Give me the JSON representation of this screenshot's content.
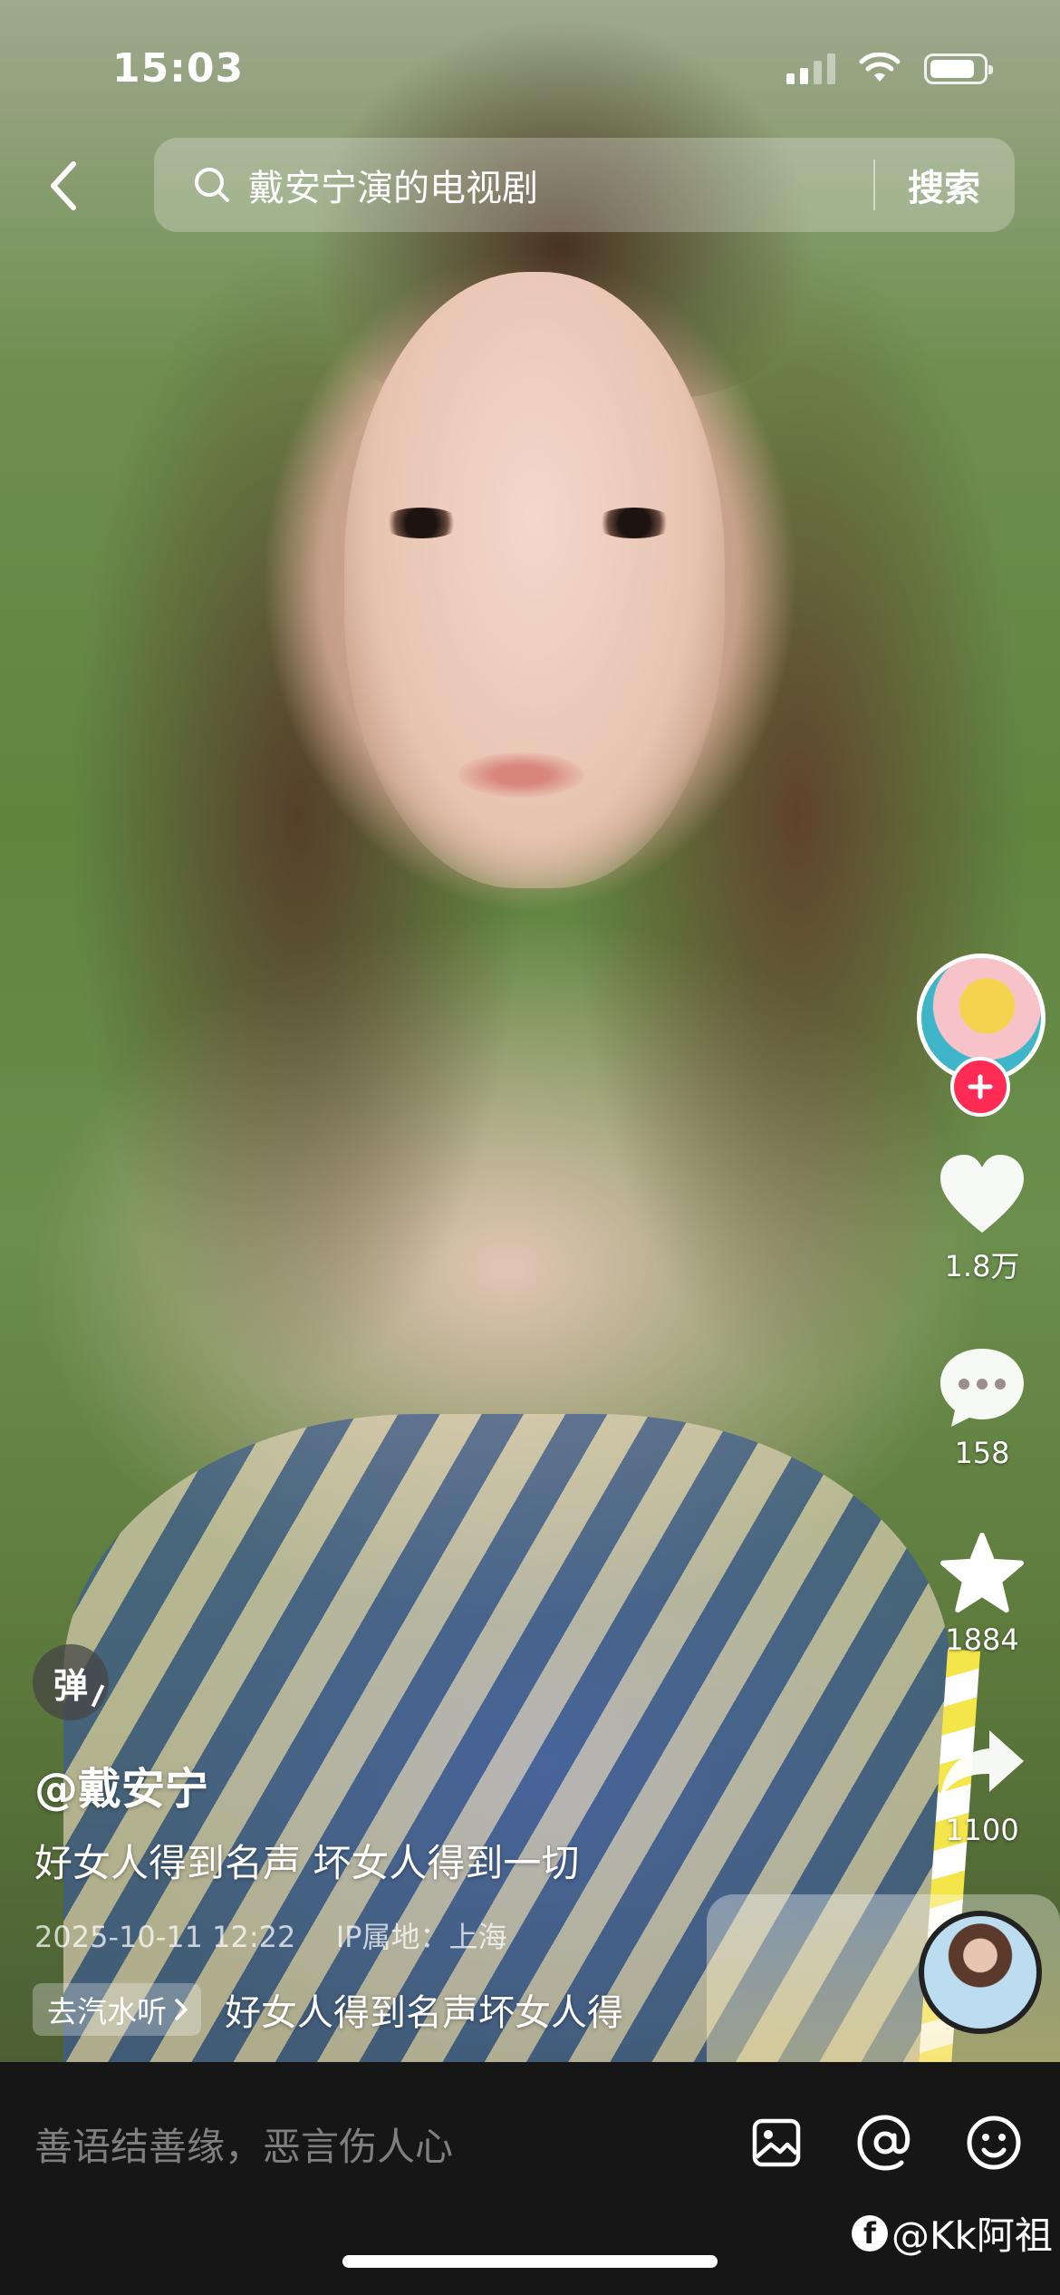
{
  "status_bar": {
    "time": "15:03",
    "battery_level": 0.85
  },
  "search": {
    "query": "戴安宁演的电视剧",
    "button_label": "搜索"
  },
  "actions": {
    "likes": "1.8万",
    "comments": "158",
    "favorites": "1884",
    "shares": "1100"
  },
  "post": {
    "danmaku_label": "弹",
    "author": "@戴安宁",
    "caption": "好女人得到名声 坏女人得到一切",
    "date": "2025-10-11 12:22",
    "ip_location": "IP属地：上海",
    "music_tag": "去汽水听",
    "music_title": "好女人得到名声坏女人得"
  },
  "comment_bar": {
    "placeholder": "善语结善缘，恶言伤人心"
  },
  "watermark": {
    "text": "@Kk阿祖"
  },
  "colors": {
    "accent": "#fe2c55",
    "bar_bg": "#161616"
  },
  "icons": [
    "back-arrow-icon",
    "search-icon",
    "heart-icon",
    "comment-bubble-icon",
    "star-icon",
    "share-arrow-icon",
    "image-icon",
    "at-sign-icon",
    "emoji-icon",
    "plus-icon",
    "wifi-icon",
    "signal-icon",
    "battery-icon"
  ]
}
